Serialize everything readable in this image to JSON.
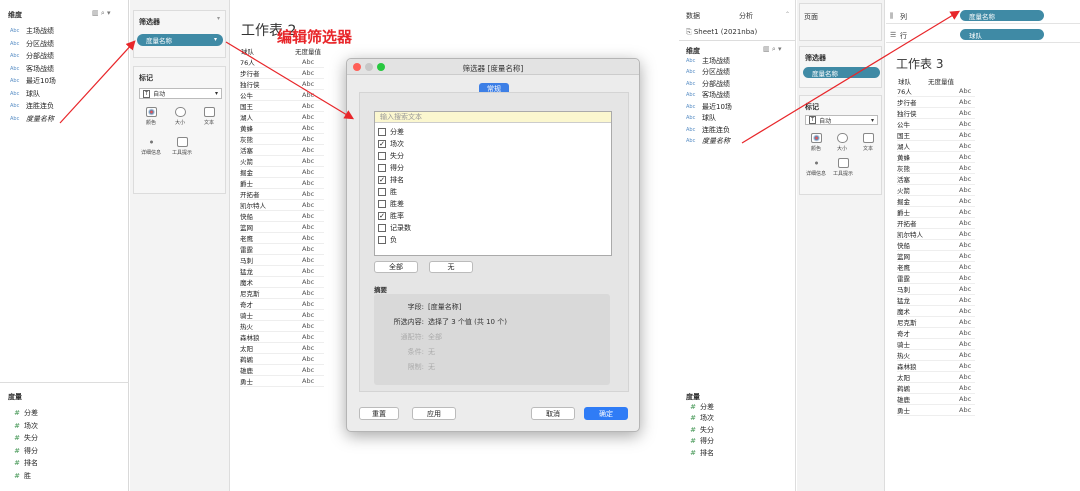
{
  "left": {
    "dim_header": "维度",
    "dims": [
      {
        "type": "Abc",
        "label": "主场战绩"
      },
      {
        "type": "Abc",
        "label": "分区战绩"
      },
      {
        "type": "Abc",
        "label": "分部战绩"
      },
      {
        "type": "Abc",
        "label": "客场战绩"
      },
      {
        "type": "Abc",
        "label": "最近10场"
      },
      {
        "type": "Abc",
        "label": "球队"
      },
      {
        "type": "Abc",
        "label": "连胜连负"
      },
      {
        "type": "Abc",
        "label": "度量名称"
      }
    ],
    "measure_header": "度量",
    "measures": [
      {
        "type": "#",
        "label": "分差"
      },
      {
        "type": "#",
        "label": "场次"
      },
      {
        "type": "#",
        "label": "失分"
      },
      {
        "type": "#",
        "label": "得分"
      },
      {
        "type": "#",
        "label": "排名"
      },
      {
        "type": "#",
        "label": "胜"
      }
    ],
    "filters_title": "筛选器",
    "filter_pill": "度量名称",
    "marks_title": "标记",
    "mark_type": "自动",
    "mark_cards": [
      "颜色",
      "大小",
      "文本",
      "详细信息",
      "工具提示"
    ],
    "sheet_title": "工作表 2",
    "col_team": "球队",
    "col_measure": "无度量值",
    "annotation": "编辑筛选器"
  },
  "teams": [
    "76人",
    "步行者",
    "独行侠",
    "公牛",
    "国王",
    "湖人",
    "黄蜂",
    "灰熊",
    "活塞",
    "火箭",
    "掘金",
    "爵士",
    "开拓者",
    "凯尔特人",
    "快船",
    "篮网",
    "老鹰",
    "雷霆",
    "马刺",
    "猛龙",
    "魔术",
    "尼克斯",
    "奇才",
    "骑士",
    "热火",
    "森林狼",
    "太阳",
    "鹈鹕",
    "雄鹿",
    "勇士"
  ],
  "cell_value": "Abc",
  "dialog": {
    "title": "筛选器 [度量名称]",
    "tab": "常规",
    "search_placeholder": "输入搜索文本",
    "items": [
      {
        "label": "分差",
        "checked": false
      },
      {
        "label": "场次",
        "checked": true
      },
      {
        "label": "失分",
        "checked": false
      },
      {
        "label": "得分",
        "checked": false
      },
      {
        "label": "排名",
        "checked": true
      },
      {
        "label": "胜",
        "checked": false
      },
      {
        "label": "胜差",
        "checked": false
      },
      {
        "label": "胜率",
        "checked": true
      },
      {
        "label": "记录数",
        "checked": false
      },
      {
        "label": "负",
        "checked": false
      }
    ],
    "all_btn": "全部",
    "none_btn": "无",
    "summary_title": "摘要",
    "summary": [
      {
        "k": "字段:",
        "v": "[度量名称]",
        "dim": false
      },
      {
        "k": "所选内容:",
        "v": "选择了 3 个值 (共 10 个)",
        "dim": false
      },
      {
        "k": "通配符:",
        "v": "全部",
        "dim": true
      },
      {
        "k": "条件:",
        "v": "无",
        "dim": true
      },
      {
        "k": "限制:",
        "v": "无",
        "dim": true
      }
    ],
    "reset_btn": "重置",
    "apply_btn": "应用",
    "cancel_btn": "取消",
    "ok_btn": "确定"
  },
  "right": {
    "tab_data": "数据",
    "tab_analysis": "分析",
    "source": "Sheet1 (2021nba)",
    "dim_header": "维度",
    "dims": [
      {
        "type": "Abc",
        "label": "主场战绩"
      },
      {
        "type": "Abc",
        "label": "分区战绩"
      },
      {
        "type": "Abc",
        "label": "分部战绩"
      },
      {
        "type": "Abc",
        "label": "客场战绩"
      },
      {
        "type": "Abc",
        "label": "最近10场"
      },
      {
        "type": "Abc",
        "label": "球队"
      },
      {
        "type": "Abc",
        "label": "连胜连负"
      },
      {
        "type": "Abc",
        "label": "度量名称"
      }
    ],
    "measure_header": "度量",
    "measures": [
      {
        "type": "#",
        "label": "分差"
      },
      {
        "type": "#",
        "label": "场次"
      },
      {
        "type": "#",
        "label": "失分"
      },
      {
        "type": "#",
        "label": "得分"
      },
      {
        "type": "#",
        "label": "排名"
      }
    ],
    "pages": "页面",
    "filters_title": "筛选器",
    "filter_pill": "度量名称",
    "marks_title": "标记",
    "mark_type": "自动",
    "mark_cards": [
      "颜色",
      "大小",
      "文本",
      "详细信息",
      "工具提示"
    ],
    "cols_label": "列",
    "rows_label": "行",
    "col_pill": "度量名称",
    "row_pill": "球队",
    "sheet_title": "工作表 3",
    "col_team": "球队",
    "col_measure": "无度量值"
  }
}
